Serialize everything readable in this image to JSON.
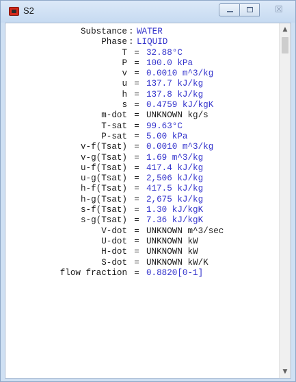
{
  "window": {
    "title": "S2",
    "icon": "app-icon",
    "controls": {
      "minimize_icon": "minimize-icon",
      "maximize_icon": "maximize-icon",
      "close_icon": "close-icon",
      "close_glyph": "☒"
    }
  },
  "properties": [
    {
      "label": "Substance",
      "sep": ":",
      "value": "WATER",
      "known": true
    },
    {
      "label": "Phase",
      "sep": ":",
      "value": "LIQUID",
      "known": true
    },
    {
      "label": "T",
      "sep": "=",
      "value": "32.88°C",
      "known": true
    },
    {
      "label": "P",
      "sep": "=",
      "value": "100.0 kPa",
      "known": true
    },
    {
      "label": "v",
      "sep": "=",
      "value": "0.0010 m^3/kg",
      "known": true
    },
    {
      "label": "u",
      "sep": "=",
      "value": "137.7 kJ/kg",
      "known": true
    },
    {
      "label": "h",
      "sep": "=",
      "value": "137.8 kJ/kg",
      "known": true
    },
    {
      "label": "s",
      "sep": "=",
      "value": "0.4759 kJ/kgK",
      "known": true
    },
    {
      "label": "m-dot",
      "sep": "=",
      "value": "UNKNOWN kg/s",
      "known": false
    },
    {
      "label": "T-sat",
      "sep": "=",
      "value": "99.63°C",
      "known": true
    },
    {
      "label": "P-sat",
      "sep": "=",
      "value": "5.00 kPa",
      "known": true
    },
    {
      "label": "v-f(Tsat)",
      "sep": "=",
      "value": "0.0010 m^3/kg",
      "known": true
    },
    {
      "label": "v-g(Tsat)",
      "sep": "=",
      "value": "1.69 m^3/kg",
      "known": true
    },
    {
      "label": "u-f(Tsat)",
      "sep": "=",
      "value": "417.4 kJ/kg",
      "known": true
    },
    {
      "label": "u-g(Tsat)",
      "sep": "=",
      "value": "2,506 kJ/kg",
      "known": true
    },
    {
      "label": "h-f(Tsat)",
      "sep": "=",
      "value": "417.5 kJ/kg",
      "known": true
    },
    {
      "label": "h-g(Tsat)",
      "sep": "=",
      "value": "2,675 kJ/kg",
      "known": true
    },
    {
      "label": "s-f(Tsat)",
      "sep": "=",
      "value": "1.30 kJ/kgK",
      "known": true
    },
    {
      "label": "s-g(Tsat)",
      "sep": "=",
      "value": "7.36 kJ/kgK",
      "known": true
    },
    {
      "label": "V-dot",
      "sep": "=",
      "value": "UNKNOWN m^3/sec",
      "known": false
    },
    {
      "label": "U-dot",
      "sep": "=",
      "value": "UNKNOWN kW",
      "known": false
    },
    {
      "label": "H-dot",
      "sep": "=",
      "value": "UNKNOWN kW",
      "known": false
    },
    {
      "label": "S-dot",
      "sep": "=",
      "value": "UNKNOWN kW/K",
      "known": false
    },
    {
      "label": "flow fraction",
      "sep": "=",
      "value": "0.8820[0-1]",
      "known": true
    }
  ],
  "colors": {
    "known_value": "#3333cc",
    "unknown_value": "#1a1a1a"
  },
  "scrollbar": {
    "up_glyph": "▲",
    "down_glyph": "▼"
  }
}
